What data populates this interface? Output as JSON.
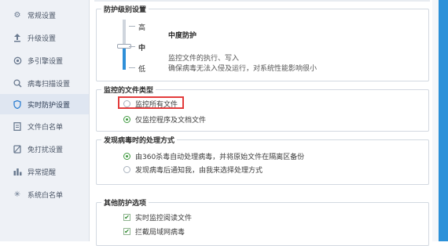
{
  "sidebar": {
    "items": [
      {
        "label": "常规设置",
        "icon": "gear-icon"
      },
      {
        "label": "升级设置",
        "icon": "upload-icon"
      },
      {
        "label": "多引擎设置",
        "icon": "engine-icon"
      },
      {
        "label": "病毒扫描设置",
        "icon": "search-icon"
      },
      {
        "label": "实时防护设置",
        "icon": "shield-icon",
        "active": true
      },
      {
        "label": "文件白名单",
        "icon": "file-icon"
      },
      {
        "label": "免打扰设置",
        "icon": "bell-off-icon"
      },
      {
        "label": "异常提醒",
        "icon": "chart-icon"
      },
      {
        "label": "系统白名单",
        "icon": "asterisk-icon"
      }
    ]
  },
  "protection_level": {
    "title": "防护级别设置",
    "levels": {
      "high": "高",
      "mid": "中",
      "low": "低"
    },
    "selected": "中",
    "mode_title": "中度防护",
    "desc_line1": "监控文件的执行、写入",
    "desc_line2": "确保病毒无法入侵及运行，对系统性能影响很小"
  },
  "file_types": {
    "title": "监控的文件类型",
    "option_all": "监控所有文件",
    "option_program": "仅监控程序及文档文件",
    "selected": "option_program"
  },
  "virus_action": {
    "title": "发现病毒时的处理方式",
    "option_auto": "由360杀毒自动处理病毒，并将原始文件在隔离区备份",
    "option_notify": "发现病毒后通知我，由我来选择处理方式",
    "selected": "option_auto"
  },
  "other_options": {
    "title": "其他防护选项",
    "option_read": "实时监控阅读文件",
    "option_lan": "拦截局域网病毒",
    "checked": [
      "option_read",
      "option_lan"
    ]
  },
  "colors": {
    "accent": "#2f8fd8",
    "highlight": "#e33b3b",
    "sidebar_bg": "#eef1f6",
    "check": "#3f9a3f"
  }
}
